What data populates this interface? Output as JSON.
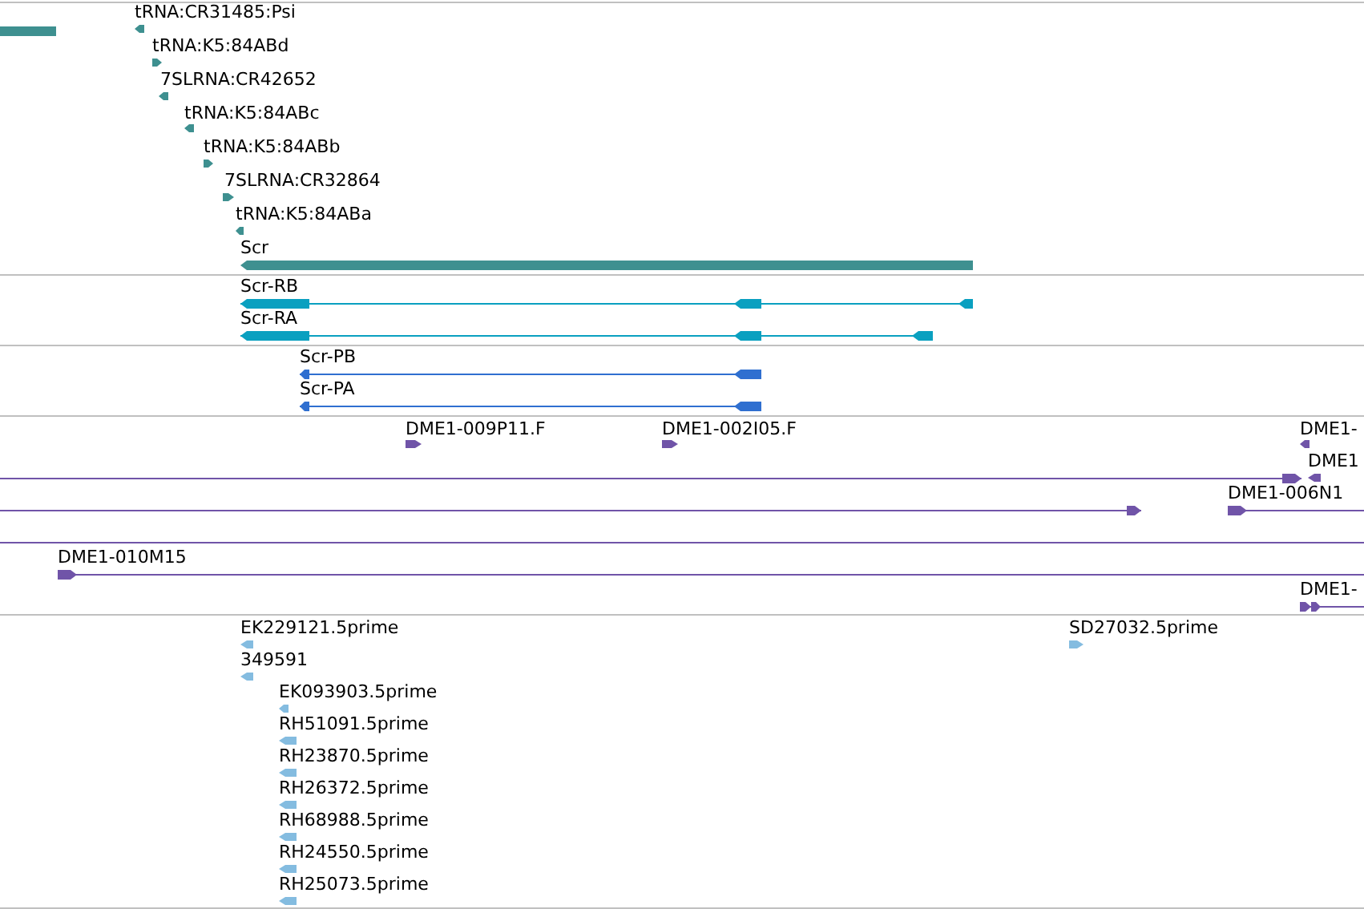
{
  "tracks": [
    {
      "color": "#3e9090",
      "features": [
        {
          "kind": "block"
        },
        {
          "label": "tRNA:CR31485:Psi",
          "kind": "point",
          "reverse": true
        },
        {
          "label": "tRNA:K5:84ABd",
          "kind": "point",
          "reverse": false
        },
        {
          "label": "7SLRNA:CR42652",
          "kind": "point",
          "reverse": true
        },
        {
          "label": "tRNA:K5:84ABc",
          "kind": "point",
          "reverse": true
        },
        {
          "label": "tRNA:K5:84ABb",
          "kind": "point",
          "reverse": false
        },
        {
          "label": "7SLRNA:CR32864",
          "kind": "point",
          "reverse": false
        },
        {
          "label": "tRNA:K5:84ABa",
          "kind": "point",
          "reverse": true
        },
        {
          "label": "Scr",
          "kind": "bar",
          "reverse": true
        }
      ]
    },
    {
      "color": "#0aa0c0",
      "features": [
        {
          "label": "Scr-RB",
          "kind": "transcript",
          "reverse": true
        },
        {
          "label": "Scr-RA",
          "kind": "transcript",
          "reverse": true
        }
      ]
    },
    {
      "color": "#2f6fd0",
      "features": [
        {
          "label": "Scr-PB",
          "kind": "transcript",
          "reverse": true
        },
        {
          "label": "Scr-PA",
          "kind": "transcript",
          "reverse": true
        }
      ]
    },
    {
      "color": "#7054a8",
      "features": [
        {
          "label": "DME1-009P11.F",
          "kind": "point",
          "reverse": false
        },
        {
          "label": "DME1-002I05.F",
          "kind": "point",
          "reverse": false
        },
        {
          "label": "DME1-",
          "kind": "point",
          "reverse": true
        },
        {
          "kind": "line",
          "reverse": false
        },
        {
          "label": "DME1",
          "kind": "point",
          "reverse": true
        },
        {
          "kind": "line",
          "reverse": false
        },
        {
          "label": "DME1-006N1",
          "kind": "line",
          "reverse": false
        },
        {
          "kind": "rule"
        },
        {
          "label": "DME1-010M15",
          "kind": "line",
          "reverse": false
        },
        {
          "label": "DME1-",
          "kind": "line",
          "reverse": false
        }
      ]
    },
    {
      "color": "#84bce0",
      "features": [
        {
          "label": "EK229121.5prime",
          "kind": "point",
          "reverse": true
        },
        {
          "label": "349591",
          "kind": "point",
          "reverse": true
        },
        {
          "label": "EK093903.5prime",
          "kind": "point",
          "reverse": true
        },
        {
          "label": "RH51091.5prime",
          "kind": "point",
          "reverse": true
        },
        {
          "label": "RH23870.5prime",
          "kind": "point",
          "reverse": true
        },
        {
          "label": "RH26372.5prime",
          "kind": "point",
          "reverse": true
        },
        {
          "label": "RH68988.5prime",
          "kind": "point",
          "reverse": true
        },
        {
          "label": "RH24550.5prime",
          "kind": "point",
          "reverse": true
        },
        {
          "label": "RH25073.5prime",
          "kind": "point",
          "reverse": true
        },
        {
          "label": "SD27032.5prime",
          "kind": "point",
          "reverse": false
        }
      ]
    }
  ]
}
